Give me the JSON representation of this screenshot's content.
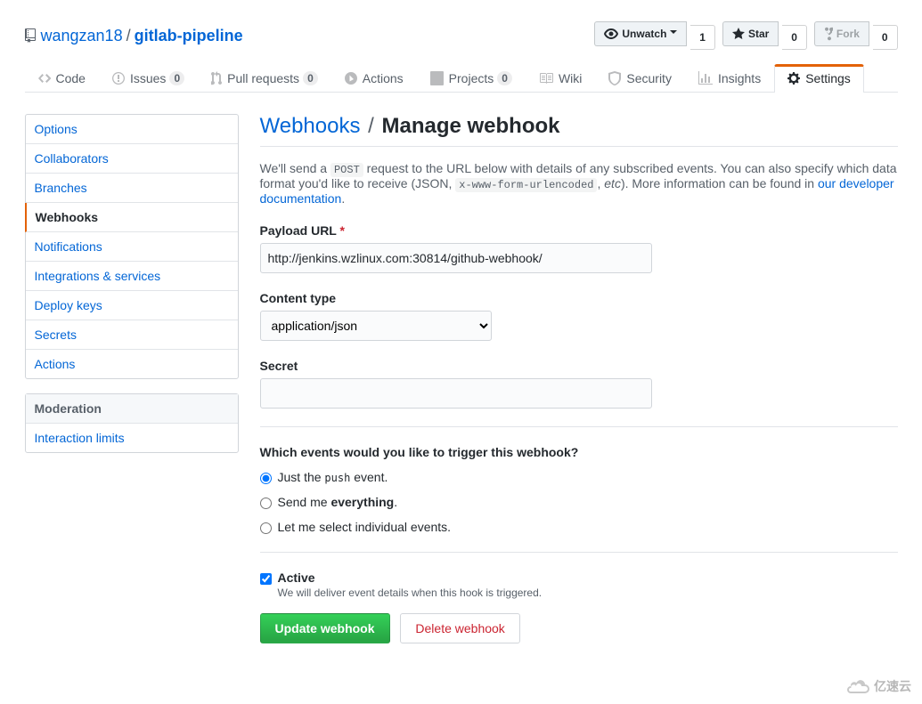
{
  "repo": {
    "owner": "wangzan18",
    "name": "gitlab-pipeline"
  },
  "actions": {
    "watch": {
      "label": "Unwatch",
      "count": "1"
    },
    "star": {
      "label": "Star",
      "count": "0"
    },
    "fork": {
      "label": "Fork",
      "count": "0"
    }
  },
  "tabs": [
    {
      "label": "Code"
    },
    {
      "label": "Issues",
      "count": "0"
    },
    {
      "label": "Pull requests",
      "count": "0"
    },
    {
      "label": "Actions"
    },
    {
      "label": "Projects",
      "count": "0"
    },
    {
      "label": "Wiki"
    },
    {
      "label": "Security"
    },
    {
      "label": "Insights"
    },
    {
      "label": "Settings"
    }
  ],
  "side_primary": [
    "Options",
    "Collaborators",
    "Branches",
    "Webhooks",
    "Notifications",
    "Integrations & services",
    "Deploy keys",
    "Secrets",
    "Actions"
  ],
  "side_mod_heading": "Moderation",
  "side_mod": [
    "Interaction limits"
  ],
  "subhead": {
    "crumb": "Webhooks",
    "sep": "/",
    "current": "Manage webhook"
  },
  "desc": {
    "pre": "We'll send a ",
    "code1": "POST",
    "mid1": " request to the URL below with details of any subscribed events. You can also specify which data format you'd like to receive (JSON, ",
    "code2": "x-www-form-urlencoded",
    "mid2": ", ",
    "em": "etc",
    "mid3": "). More information can be found in ",
    "link": "our developer documentation",
    "post": "."
  },
  "form": {
    "payload_label": "Payload URL",
    "payload_value": "http://jenkins.wzlinux.com:30814/github-webhook/",
    "content_type_label": "Content type",
    "content_type_value": "application/json",
    "secret_label": "Secret",
    "secret_value": "",
    "events_heading": "Which events would you like to trigger this webhook?",
    "event_push_pre": "Just the ",
    "event_push_code": "push",
    "event_push_post": " event.",
    "event_everything_pre": "Send me ",
    "event_everything_strong": "everything",
    "event_everything_post": ".",
    "event_individual": "Let me select individual events.",
    "active_label": "Active",
    "active_note": "We will deliver event details when this hook is triggered.",
    "submit": "Update webhook",
    "delete": "Delete webhook"
  },
  "watermark": "亿速云"
}
